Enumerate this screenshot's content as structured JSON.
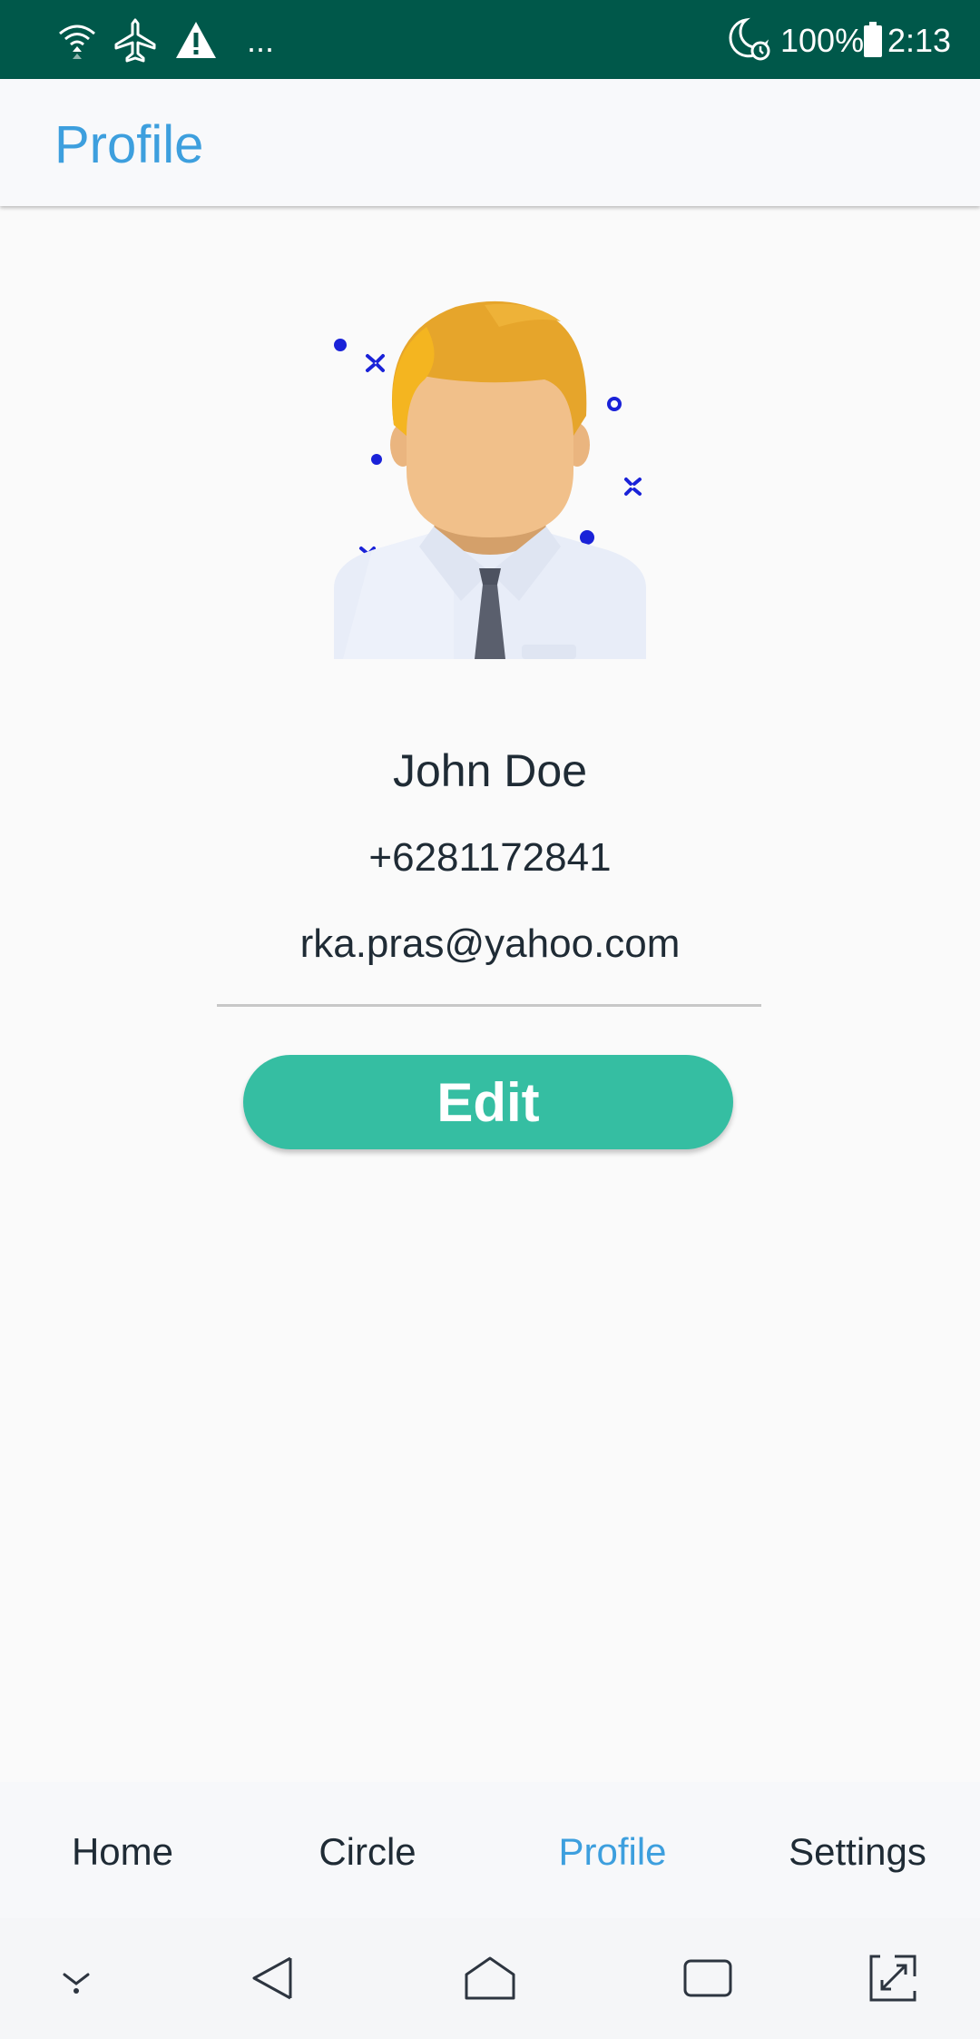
{
  "status_bar": {
    "overflow": "...",
    "battery": "100%",
    "time": "2:13",
    "icons": [
      "wifi-icon",
      "airplane-icon",
      "warning-icon",
      "moon-alarm-icon",
      "battery-icon"
    ]
  },
  "app_bar": {
    "title": "Profile"
  },
  "profile": {
    "name": "John Doe",
    "phone": "+6281172841",
    "email": "rka.pras@yahoo.com",
    "edit_label": "Edit"
  },
  "bottom_nav": {
    "items": [
      {
        "label": "Home"
      },
      {
        "label": "Circle"
      },
      {
        "label": "Profile"
      },
      {
        "label": "Settings"
      }
    ],
    "active_index": 2
  },
  "system_nav": {
    "icons": [
      "collapse-icon",
      "back-icon",
      "home-icon",
      "recents-icon",
      "screenshot-icon"
    ]
  },
  "colors": {
    "status_bar": "#00584a",
    "accent": "#3d9fde",
    "button": "#35bea2"
  }
}
